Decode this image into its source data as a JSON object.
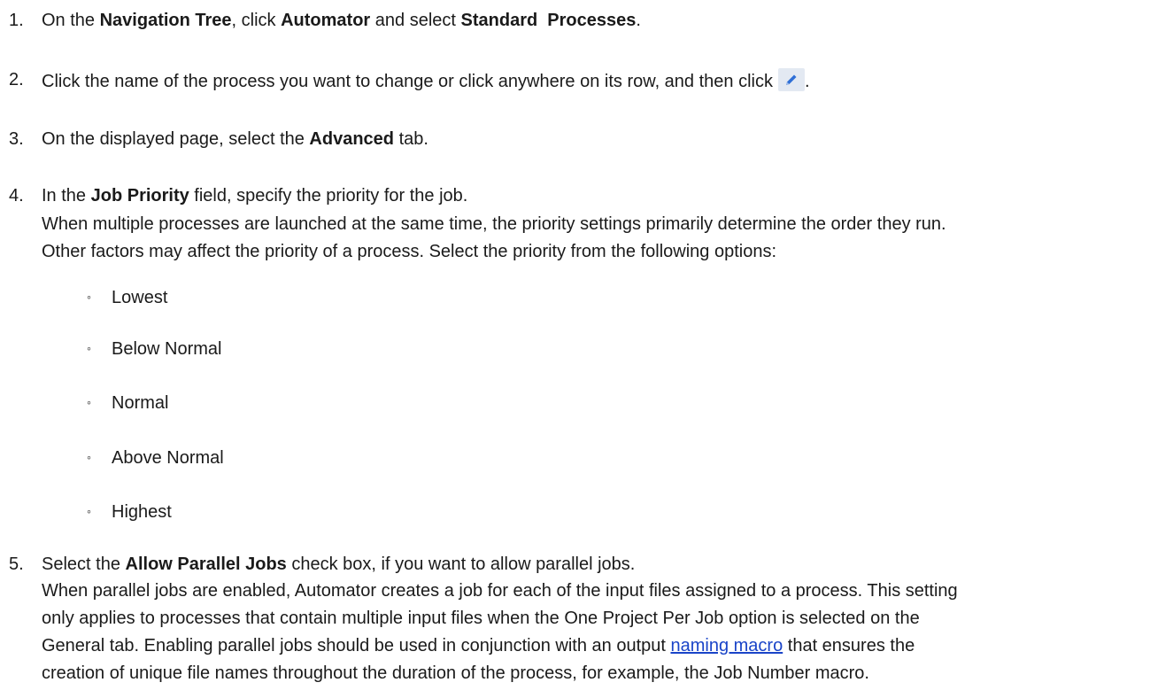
{
  "steps": [
    {
      "num": "1.",
      "t1": "On the ",
      "b1": "Navigation Tree",
      "t2": ", click ",
      "b2": "Automator",
      "t3": " and select ",
      "b3": "Standard  Processes",
      "t4": "."
    },
    {
      "num": "2.",
      "text": "Click the name of the process you want to change or click anywhere on its row, and then click",
      "after_icon": ".",
      "icon": "pencil-edit-icon"
    },
    {
      "num": "3.",
      "t1": "On the displayed page, select the ",
      "b1": "Advanced",
      "t2": " tab."
    },
    {
      "num": "4.",
      "t1": "In the ",
      "b1": "Job Priority",
      "t2": " field, specify the priority for the job.",
      "p1": "When multiple processes are launched at the same time, the priority settings primarily determine the order they run.",
      "p2": "Other factors may affect the priority of a process. Select the priority from the following options:",
      "options": [
        "Lowest",
        "Below Normal",
        "Normal",
        "Above Normal",
        "Highest"
      ]
    },
    {
      "num": "5.",
      "t1": "Select the ",
      "b1": "Allow Parallel Jobs",
      "t2": " check box, if you want to allow parallel jobs.",
      "p1": "When parallel jobs are enabled, Automator creates a job for each of the input files assigned to a process. This setting",
      "p2": "only applies to processes that contain multiple input files when the One Project Per Job option is selected on the",
      "p3a": "General tab. Enabling parallel jobs should be used in conjunction with an output ",
      "link": "naming macro",
      "p3b": " that ensures the",
      "p4": "creation of unique file names throughout the duration of the process, for example, the Job Number macro."
    }
  ],
  "bullet_glyph": "◦"
}
